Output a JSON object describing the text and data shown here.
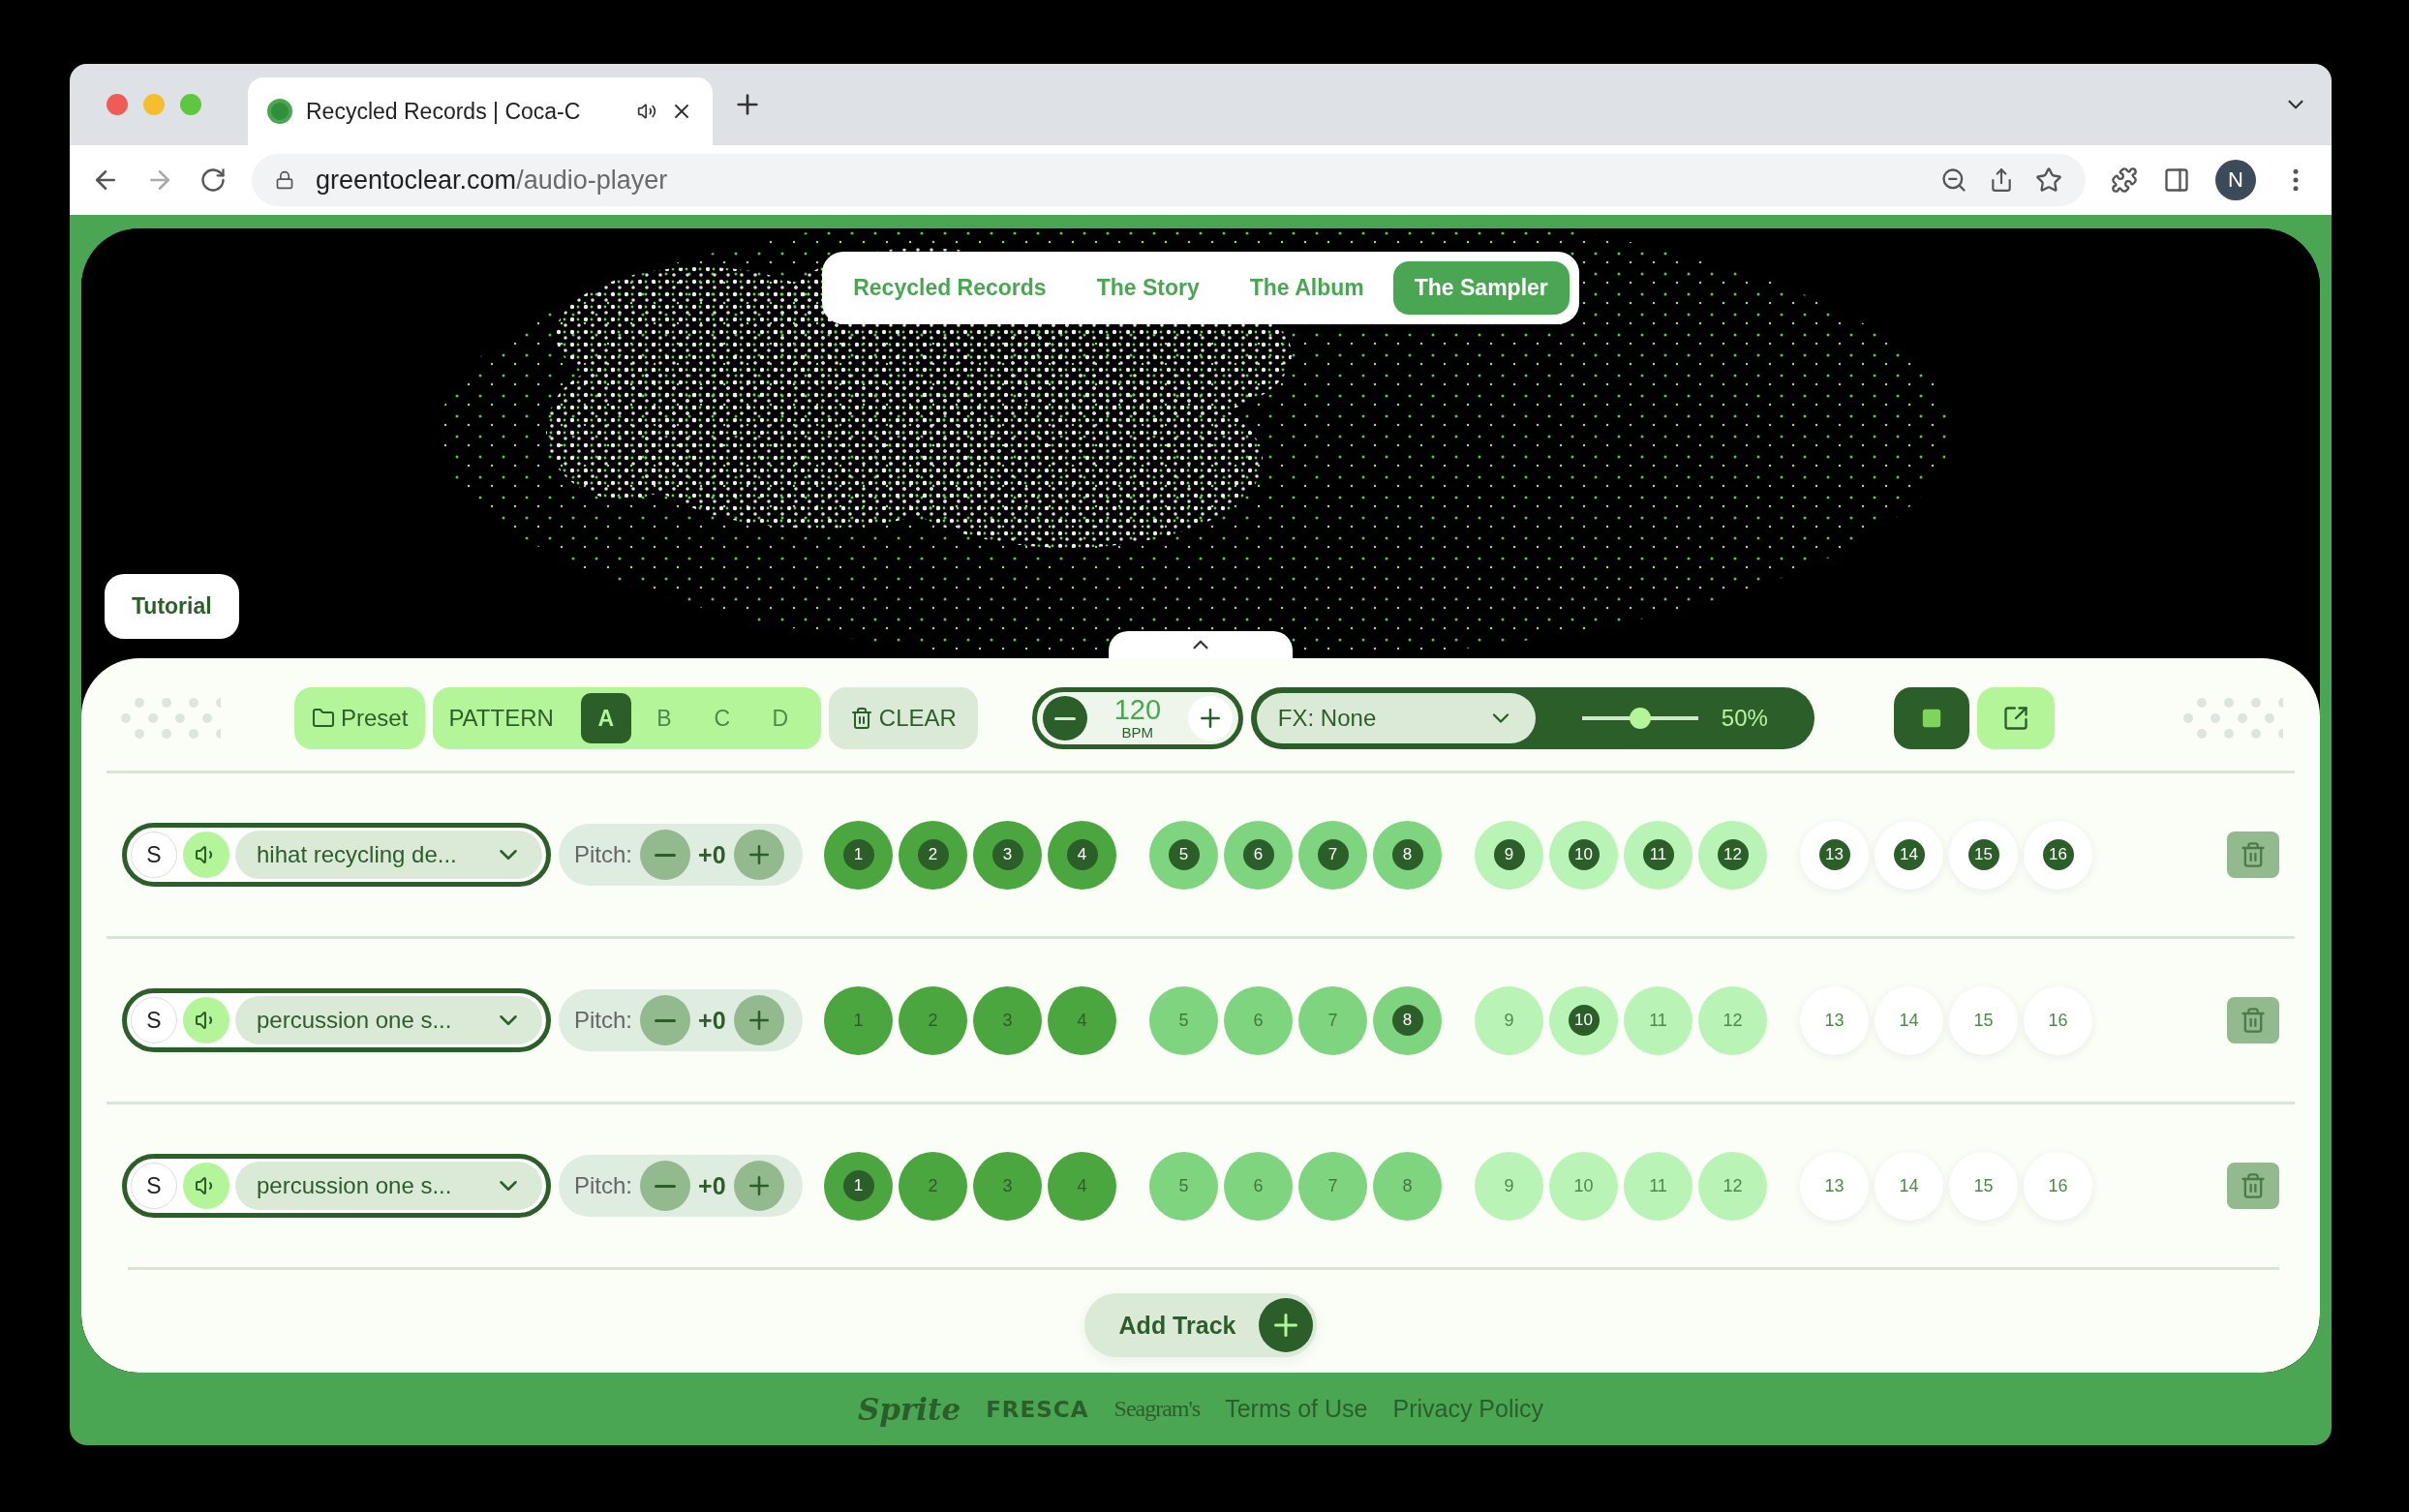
{
  "browser": {
    "tab_title": "Recycled Records | Coca-C",
    "address_domain": "greentoclear.com",
    "address_path": "/audio-player",
    "profile_initial": "N"
  },
  "nav": [
    {
      "label": "Recycled Records",
      "selected": false
    },
    {
      "label": "The Story",
      "selected": false
    },
    {
      "label": "The Album",
      "selected": false
    },
    {
      "label": "The Sampler",
      "selected": true
    }
  ],
  "tutorial_button": "Tutorial",
  "toolbar": {
    "preset": "Preset",
    "pattern_label": "PATTERN",
    "patterns": [
      {
        "label": "A",
        "selected": true
      },
      {
        "label": "B",
        "selected": false
      },
      {
        "label": "C",
        "selected": false
      },
      {
        "label": "D",
        "selected": false
      }
    ],
    "clear": "CLEAR",
    "bpm": "120",
    "bpm_unit": "BPM",
    "fx": "FX: None",
    "volume": {
      "level": 0.5,
      "reading": "50%"
    }
  },
  "tracks": [
    {
      "solo": "S",
      "name": "hihat recycling de...",
      "pitch_label": "Pitch:",
      "pitch": "+0",
      "steps": [
        {
          "label": "1",
          "on": true
        },
        {
          "label": "2",
          "on": true
        },
        {
          "label": "3",
          "on": true
        },
        {
          "label": "4",
          "on": true
        },
        {
          "label": "5",
          "on": true
        },
        {
          "label": "6",
          "on": true
        },
        {
          "label": "7",
          "on": true
        },
        {
          "label": "8",
          "on": true
        },
        {
          "label": "9",
          "on": true
        },
        {
          "label": "10",
          "on": true
        },
        {
          "label": "11",
          "on": true
        },
        {
          "label": "12",
          "on": true
        },
        {
          "label": "13",
          "on": true
        },
        {
          "label": "14",
          "on": true
        },
        {
          "label": "15",
          "on": true
        },
        {
          "label": "16",
          "on": true
        }
      ]
    },
    {
      "solo": "S",
      "name": "percussion one s...",
      "pitch_label": "Pitch:",
      "pitch": "+0",
      "steps": [
        {
          "label": "1",
          "on": false
        },
        {
          "label": "2",
          "on": false
        },
        {
          "label": "3",
          "on": false
        },
        {
          "label": "4",
          "on": false
        },
        {
          "label": "5",
          "on": false
        },
        {
          "label": "6",
          "on": false
        },
        {
          "label": "7",
          "on": false
        },
        {
          "label": "8",
          "on": true
        },
        {
          "label": "9",
          "on": false
        },
        {
          "label": "10",
          "on": true
        },
        {
          "label": "11",
          "on": false
        },
        {
          "label": "12",
          "on": false
        },
        {
          "label": "13",
          "on": false
        },
        {
          "label": "14",
          "on": false
        },
        {
          "label": "15",
          "on": false
        },
        {
          "label": "16",
          "on": false
        }
      ]
    },
    {
      "solo": "S",
      "name": "percussion one s...",
      "pitch_label": "Pitch:",
      "pitch": "+0",
      "steps": [
        {
          "label": "1",
          "on": true
        },
        {
          "label": "2",
          "on": false
        },
        {
          "label": "3",
          "on": false
        },
        {
          "label": "4",
          "on": false
        },
        {
          "label": "5",
          "on": false
        },
        {
          "label": "6",
          "on": false
        },
        {
          "label": "7",
          "on": false
        },
        {
          "label": "8",
          "on": false
        },
        {
          "label": "9",
          "on": false
        },
        {
          "label": "10",
          "on": false
        },
        {
          "label": "11",
          "on": false
        },
        {
          "label": "12",
          "on": false
        },
        {
          "label": "13",
          "on": false
        },
        {
          "label": "14",
          "on": false
        },
        {
          "label": "15",
          "on": false
        },
        {
          "label": "16",
          "on": false
        }
      ]
    }
  ],
  "add_track": "Add Track",
  "footer": {
    "brands": [
      {
        "label": "Sprite",
        "kind": "script"
      },
      {
        "label": "FRESCA",
        "kind": "block"
      },
      {
        "label": "Seagram's",
        "kind": "serif"
      }
    ],
    "links": [
      "Terms of Use",
      "Privacy Policy"
    ]
  }
}
